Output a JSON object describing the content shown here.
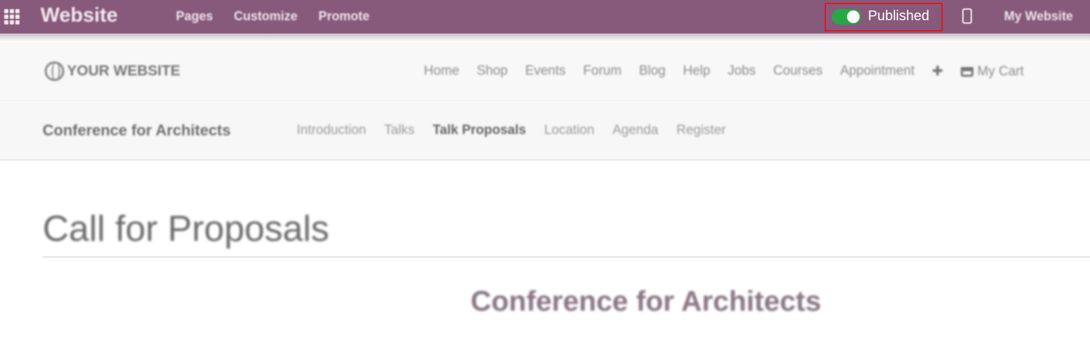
{
  "topbar": {
    "app_title": "Website",
    "menu": [
      "Pages",
      "Customize",
      "Promote"
    ],
    "published_label": "Published",
    "published_on": true,
    "my_website": "My Website",
    "icons": {
      "apps": "apps-grid-icon",
      "mobile": "mobile-preview-icon"
    },
    "colors": {
      "bar": "#875a7b",
      "toggle_on": "#28a745",
      "highlight": "#e0161f"
    }
  },
  "site_nav": {
    "logo_text": "YOUR WEBSITE",
    "menu": [
      "Home",
      "Shop",
      "Events",
      "Forum",
      "Blog",
      "Help",
      "Jobs",
      "Courses",
      "Appointment"
    ],
    "add_symbol": "✚",
    "cart_label": "My Cart"
  },
  "event_nav": {
    "title": "Conference for Architects",
    "menu": [
      "Introduction",
      "Talks",
      "Talk Proposals",
      "Location",
      "Agenda",
      "Register"
    ],
    "active": "Talk Proposals"
  },
  "main": {
    "heading": "Call for Proposals",
    "event_name": "Conference for Architects"
  }
}
